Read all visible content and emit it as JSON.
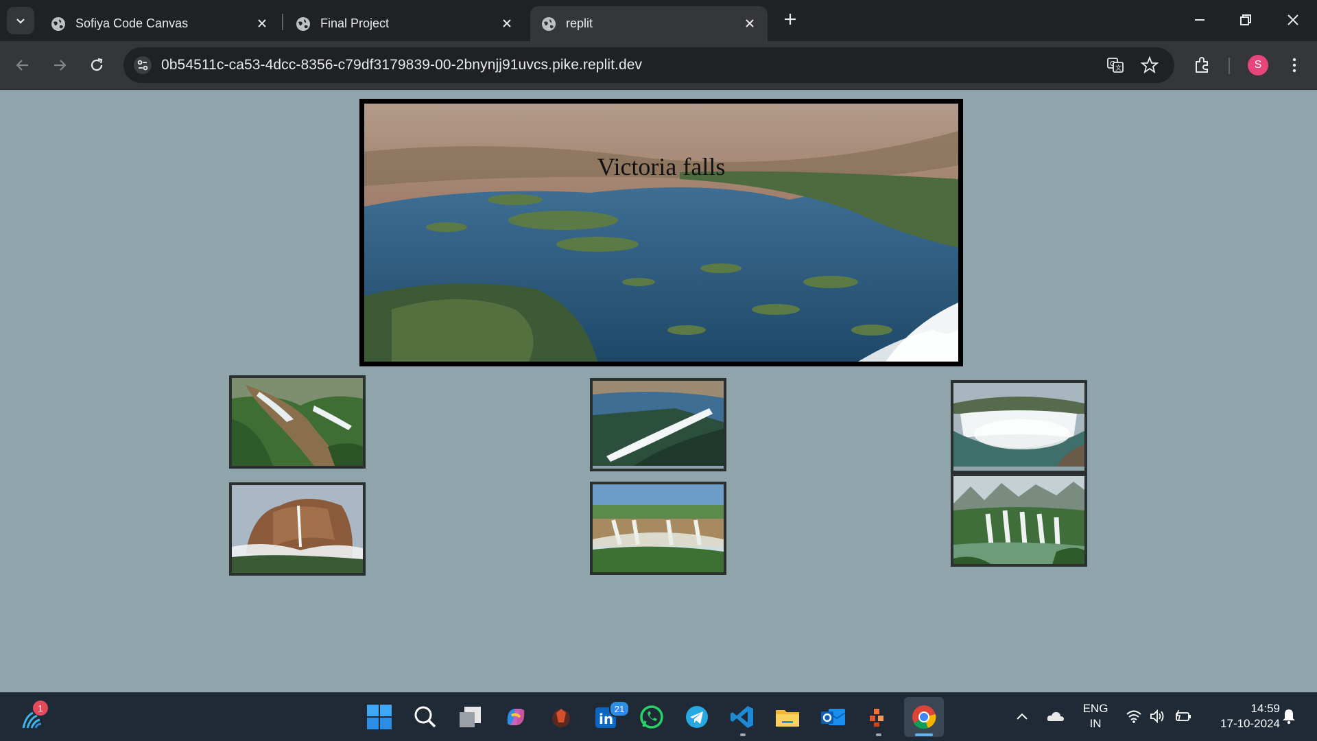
{
  "browser": {
    "tabs": [
      {
        "title": "Sofiya Code Canvas",
        "active": false
      },
      {
        "title": "Final Project",
        "active": false
      },
      {
        "title": "replit",
        "active": true
      }
    ],
    "url": "0b54511c-ca53-4dcc-8356-c79df3179839-00-2bnynjj91uvcs.pike.replit.dev",
    "profile_initial": "S"
  },
  "page": {
    "hero_title": "Victoria falls",
    "thumbnails": [
      "waterfall-aerial-gorge",
      "victoria-falls-aerial",
      "horseshoe-falls",
      "angel-falls",
      "rainbow-falls",
      "tiered-jungle-falls"
    ]
  },
  "taskbar": {
    "widget_badge": "1",
    "linkedin_badge": "21",
    "lang_line1": "ENG",
    "lang_line2": "IN",
    "time": "14:59",
    "date": "17-10-2024"
  },
  "colors": {
    "page_bg": "#8fa4ab",
    "chrome_dark": "#202124",
    "chrome_mid": "#35363a",
    "taskbar_bg": "#1f2a36",
    "profile": "#e8457a"
  }
}
